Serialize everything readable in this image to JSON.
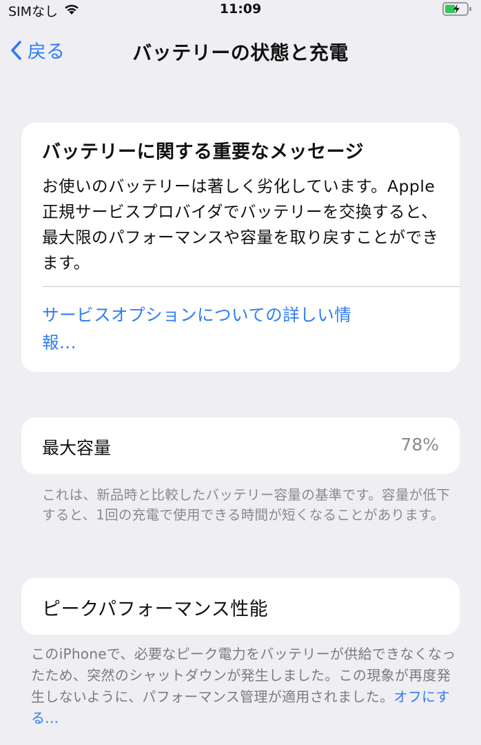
{
  "status_bar": {
    "carrier": "SIMなし",
    "time": "11:09"
  },
  "nav": {
    "back_label": "戻る",
    "title": "バッテリーの状態と充電"
  },
  "message_card": {
    "title": "バッテリーに関する重要なメッセージ",
    "body": "お使いのバッテリーは著しく劣化しています。Apple正規サービスプロバイダでバッテリーを交換すると、最大限のパフォーマンスや容量を取り戻すことができます。",
    "link": "サービスオプションについての詳しい情報..."
  },
  "capacity": {
    "label": "最大容量",
    "value": "78%",
    "footnote": "これは、新品時と比較したバッテリー容量の基準です。容量が低下すると、1回の充電で使用できる時間が短くなることがあります。"
  },
  "performance": {
    "label": "ピークパフォーマンス性能",
    "note": "このiPhoneで、必要なピーク電力をバッテリーが供給できなくなったため、突然のシャットダウンが発生しました。この現象が再度発生しないように、パフォーマンス管理が適用されました。",
    "link": "オフにする..."
  },
  "colors": {
    "accent": "#2f7bf5",
    "background": "#eeeef3",
    "battery_charging": "#34c759"
  },
  "icons": [
    "wifi-icon",
    "battery-charging-icon",
    "chevron-left-icon"
  ]
}
